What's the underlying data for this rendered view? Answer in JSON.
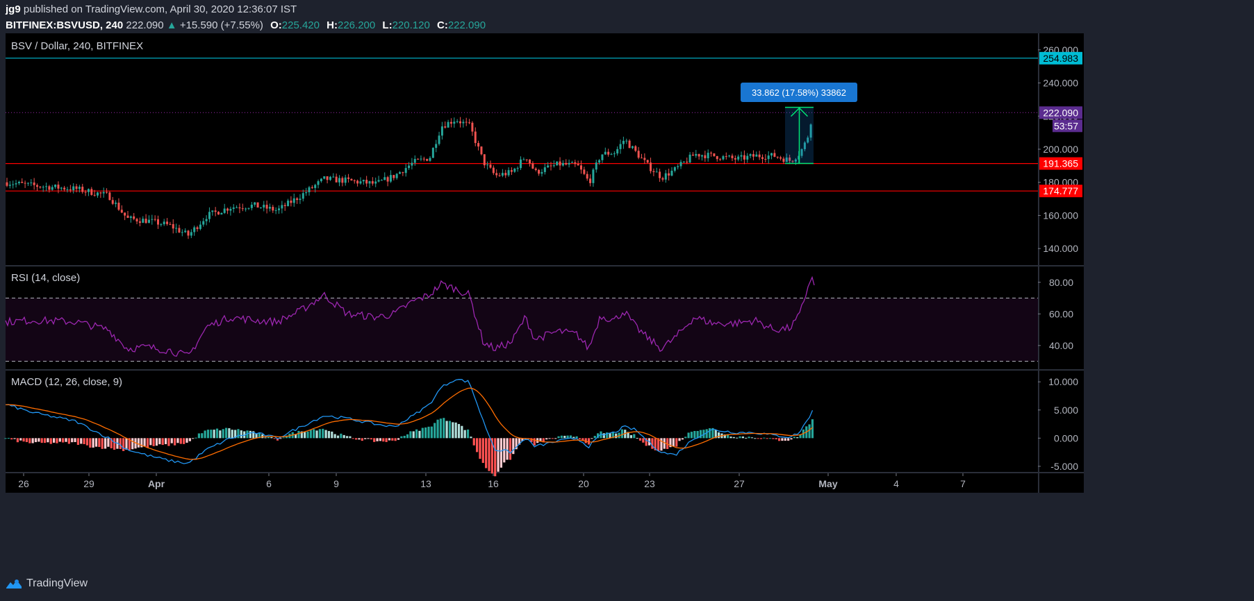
{
  "header": {
    "author": "jg9",
    "published_text": "published on TradingView.com, April 30, 2020 12:36:07 IST",
    "symbol": "BITFINEX:BSVUSD, 240",
    "last": "222.090",
    "change": "+15.590 (+7.55%)",
    "ohlc": [
      {
        "label": "O:",
        "value": "225.420"
      },
      {
        "label": "H:",
        "value": "226.200"
      },
      {
        "label": "L:",
        "value": "220.120"
      },
      {
        "label": "C:",
        "value": "222.090"
      }
    ]
  },
  "footer": {
    "brand": "TradingView",
    "logo_icon": "tradingview-logo-icon"
  },
  "colors": {
    "background": "#000000",
    "frame": "#1e222d",
    "up": "#26a69a",
    "down": "#ef5350",
    "rsi": "#9c27b0",
    "macd": "#2196f3",
    "signal": "#ff6d00",
    "resistance": "#00bcd4",
    "support": "#ff0000",
    "price_label": "#5b2c8f",
    "measure": "#1976d2",
    "measure_arrow": "#00e676"
  },
  "chart_data": [
    {
      "type": "candlestick",
      "title": "BSV / Dollar, 240, BITFINEX",
      "ylim": [
        130,
        270
      ],
      "yticks": [
        140,
        160,
        180,
        200,
        220,
        240,
        260
      ],
      "ytick_labels": [
        "140.000",
        "160.000",
        "180.000",
        "200.000",
        "220.000",
        "240.000",
        "260.000"
      ],
      "xlim": [
        25,
        38.7
      ],
      "xticks": [
        {
          "x": 25.3,
          "label": "26"
        },
        {
          "x": 28.3,
          "label": "29"
        },
        {
          "x": 31.1,
          "label": "Apr"
        },
        {
          "x": 33.1,
          "label": "6"
        },
        {
          "x": 34.2,
          "label": "9"
        },
        {
          "x": 35.5,
          "label": "13"
        },
        {
          "x": 36.6,
          "label": "16"
        },
        {
          "x": 37.6,
          "label": "20"
        },
        {
          "x": 38.5,
          "label": "23"
        }
      ],
      "levels": [
        {
          "name": "resistance",
          "value": 254.983,
          "label": "254.983"
        },
        {
          "name": "support-upper",
          "value": 191.365,
          "label": "191.365"
        },
        {
          "name": "support-lower",
          "value": 174.777,
          "label": "174.777"
        }
      ],
      "last_price": {
        "value": 222.09,
        "label": "222.090",
        "countdown": "53:57"
      },
      "measurement": {
        "from": 191.4,
        "to": 225.3,
        "label": "33.862 (17.58%) 33862"
      },
      "anchors": [
        [
          25.0,
          180
        ],
        [
          25.6,
          178
        ],
        [
          26.5,
          176
        ],
        [
          27.2,
          172
        ],
        [
          27.6,
          158
        ],
        [
          28.0,
          157
        ],
        [
          28.5,
          154
        ],
        [
          28.9,
          148
        ],
        [
          29.3,
          160
        ],
        [
          29.8,
          165
        ],
        [
          30.3,
          166
        ],
        [
          30.8,
          163
        ],
        [
          31.3,
          172
        ],
        [
          31.8,
          182
        ],
        [
          32.3,
          181
        ],
        [
          32.9,
          179
        ],
        [
          33.3,
          184
        ],
        [
          33.7,
          192
        ],
        [
          34.05,
          195
        ],
        [
          34.3,
          214
        ],
        [
          34.6,
          218
        ],
        [
          34.9,
          214
        ],
        [
          35.2,
          192
        ],
        [
          35.45,
          184
        ],
        [
          35.8,
          186
        ],
        [
          36.1,
          196
        ],
        [
          36.3,
          186
        ],
        [
          36.8,
          191
        ],
        [
          37.2,
          190
        ],
        [
          37.45,
          180
        ],
        [
          37.7,
          197
        ],
        [
          38.0,
          198
        ],
        [
          38.2,
          206
        ],
        [
          38.45,
          198
        ],
        [
          38.7,
          190
        ],
        [
          39.0,
          183
        ],
        [
          39.3,
          188
        ],
        [
          39.7,
          197
        ],
        [
          40.1,
          196
        ],
        [
          40.6,
          194
        ],
        [
          41.0,
          196
        ],
        [
          41.4,
          196
        ],
        [
          41.75,
          193
        ],
        [
          41.95,
          198
        ],
        [
          42.1,
          206
        ],
        [
          42.22,
          223
        ]
      ]
    },
    {
      "type": "line",
      "title": "RSI (14, close)",
      "ylim": [
        25,
        90
      ],
      "yticks": [
        40,
        60,
        80
      ],
      "ytick_labels": [
        "40.00",
        "60.00",
        "80.00"
      ],
      "bands": [
        30,
        70
      ],
      "series": [
        {
          "values_anchor": [
            [
              25.0,
              55
            ],
            [
              25.6,
              56
            ],
            [
              26.5,
              55
            ],
            [
              27.2,
              50
            ],
            [
              27.6,
              38
            ],
            [
              28.0,
              39
            ],
            [
              28.5,
              37
            ],
            [
              28.9,
              33
            ],
            [
              29.3,
              52
            ],
            [
              29.8,
              58
            ],
            [
              30.3,
              56
            ],
            [
              30.8,
              55
            ],
            [
              31.3,
              62
            ],
            [
              31.8,
              72
            ],
            [
              32.3,
              60
            ],
            [
              32.9,
              58
            ],
            [
              33.3,
              60
            ],
            [
              33.7,
              68
            ],
            [
              34.05,
              72
            ],
            [
              34.3,
              79
            ],
            [
              34.6,
              76
            ],
            [
              34.9,
              72
            ],
            [
              35.2,
              42
            ],
            [
              35.45,
              38
            ],
            [
              35.8,
              42
            ],
            [
              36.1,
              58
            ],
            [
              36.3,
              44
            ],
            [
              36.8,
              49
            ],
            [
              37.2,
              47
            ],
            [
              37.45,
              38
            ],
            [
              37.7,
              59
            ],
            [
              38.0,
              56
            ],
            [
              38.2,
              62
            ],
            [
              38.45,
              52
            ],
            [
              38.7,
              45
            ],
            [
              39.0,
              38
            ],
            [
              39.3,
              45
            ],
            [
              39.7,
              58
            ],
            [
              40.1,
              54
            ],
            [
              40.6,
              54
            ],
            [
              41.0,
              56
            ],
            [
              41.4,
              50
            ],
            [
              41.75,
              51
            ],
            [
              41.95,
              59
            ],
            [
              42.1,
              74
            ],
            [
              42.2,
              84
            ],
            [
              42.28,
              76
            ]
          ]
        }
      ]
    },
    {
      "type": "macd",
      "title": "MACD (12, 26, close, 9)",
      "ylim": [
        -6,
        12
      ],
      "yticks": [
        -5,
        0,
        5,
        10
      ],
      "ytick_labels": [
        "-5.000",
        "0.000",
        "5.000",
        "10.000"
      ],
      "xticks": [
        {
          "x": 25.3,
          "label": "26"
        },
        {
          "x": 28.3,
          "label": "29"
        },
        {
          "x": 31.1,
          "label": "Apr"
        },
        {
          "x": 33.1,
          "label": "6"
        },
        {
          "x": 34.2,
          "label": "9"
        },
        {
          "x": 35.5,
          "label": "13"
        },
        {
          "x": 36.6,
          "label": "16"
        },
        {
          "x": 37.6,
          "label": "20"
        },
        {
          "x": 38.5,
          "label": "23"
        },
        {
          "x": 39.6,
          "label": "27"
        },
        {
          "x": 40.5,
          "label": "May"
        },
        {
          "x": 41.6,
          "label": "4"
        },
        {
          "x": 42.7,
          "label": "7"
        }
      ],
      "series": [
        {
          "name": "macd",
          "values_anchor": [
            [
              25.0,
              6
            ],
            [
              25.6,
              4.5
            ],
            [
              26.5,
              3
            ],
            [
              27.2,
              0
            ],
            [
              27.6,
              -2
            ],
            [
              28.0,
              -3
            ],
            [
              28.5,
              -4
            ],
            [
              28.9,
              -4.5
            ],
            [
              29.3,
              -2
            ],
            [
              29.8,
              0
            ],
            [
              30.3,
              1
            ],
            [
              30.8,
              0
            ],
            [
              31.3,
              2
            ],
            [
              31.8,
              4
            ],
            [
              32.3,
              3.5
            ],
            [
              32.9,
              2.5
            ],
            [
              33.3,
              2
            ],
            [
              33.7,
              4
            ],
            [
              34.05,
              6
            ],
            [
              34.3,
              9
            ],
            [
              34.6,
              10.5
            ],
            [
              34.9,
              10
            ],
            [
              35.2,
              3
            ],
            [
              35.45,
              -2
            ],
            [
              35.8,
              -2.5
            ],
            [
              36.1,
              0
            ],
            [
              36.3,
              -1.5
            ],
            [
              36.8,
              -0.5
            ],
            [
              37.2,
              0
            ],
            [
              37.45,
              -1.5
            ],
            [
              37.7,
              0.5
            ],
            [
              38.0,
              1
            ],
            [
              38.2,
              2
            ],
            [
              38.45,
              1.5
            ],
            [
              38.7,
              -0.5
            ],
            [
              39.0,
              -2.5
            ],
            [
              39.3,
              -3
            ],
            [
              39.7,
              0
            ],
            [
              40.1,
              1.5
            ],
            [
              40.6,
              1
            ],
            [
              41.0,
              1
            ],
            [
              41.4,
              0.5
            ],
            [
              41.75,
              0.2
            ],
            [
              41.95,
              1
            ],
            [
              42.1,
              3
            ],
            [
              42.28,
              5.5
            ]
          ]
        },
        {
          "name": "signal"
        },
        {
          "name": "histogram"
        }
      ]
    }
  ]
}
